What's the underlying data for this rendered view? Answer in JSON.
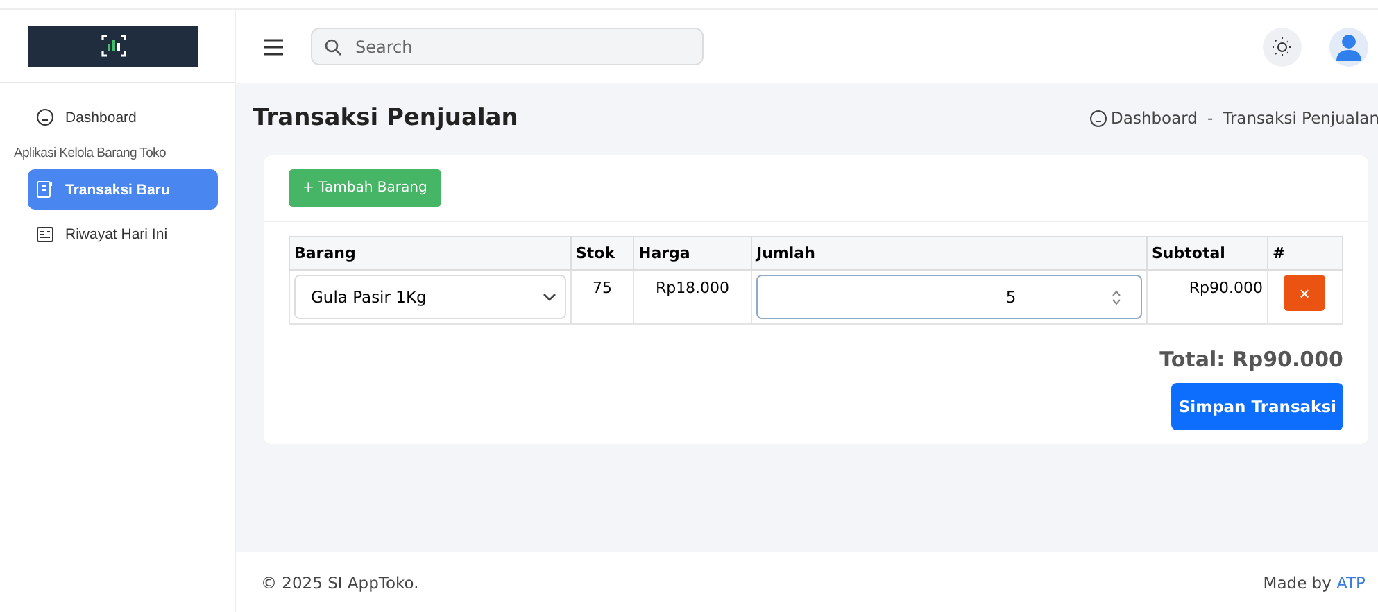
{
  "header": {
    "search": {
      "placeholder": "Search"
    }
  },
  "sidebar": {
    "items": [
      {
        "kind": "link",
        "label": "Dashboard",
        "selected": false
      },
      {
        "kind": "heading",
        "label": "Aplikasi Kelola Barang Toko"
      },
      {
        "kind": "link",
        "label": "Transaksi Baru",
        "selected": true
      },
      {
        "kind": "link",
        "label": "Riwayat Hari Ini",
        "selected": false
      }
    ]
  },
  "page": {
    "title": "Transaksi Penjualan",
    "breadcrumb": [
      "Dashboard",
      "-",
      "Transaksi Penjualan"
    ]
  },
  "card": {
    "add_button": "+ Tambah Barang",
    "table": {
      "columns": [
        "Barang",
        "Stok",
        "Harga",
        "Jumlah",
        "Subtotal",
        "#"
      ],
      "rows": [
        {
          "item": "Gula Pasir 1Kg",
          "stock": "75",
          "price": "Rp18.000",
          "quantity": "5",
          "subtotal": "Rp90.000",
          "delete": "×"
        }
      ]
    },
    "total": "Total: Rp90.000",
    "save_button": "Simpan Transaksi"
  },
  "footer": {
    "copyright": "© 2025 SI AppToko.",
    "made_by": "Made by",
    "author": "ATP"
  }
}
